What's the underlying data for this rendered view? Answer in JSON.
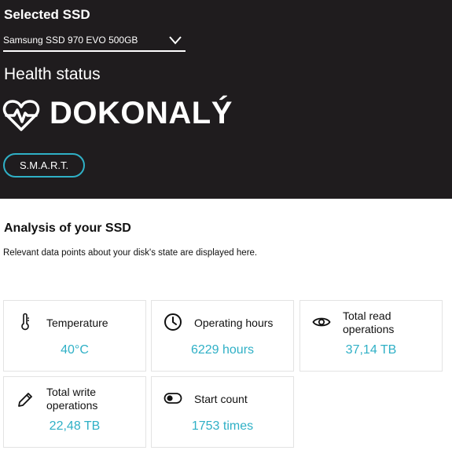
{
  "header": {
    "selected_label": "Selected SSD",
    "selected_ssd": "Samsung SSD 970 EVO 500GB",
    "health_label": "Health status",
    "health_value": "DOKONALÝ",
    "smart_button": "S.M.A.R.T."
  },
  "analysis": {
    "title": "Analysis of your SSD",
    "description": "Relevant data points about your disk's state are displayed here."
  },
  "cards": [
    {
      "label": "Temperature",
      "value": "40°C",
      "icon": "thermometer-icon"
    },
    {
      "label": "Operating hours",
      "value": "6229 hours",
      "icon": "clock-icon"
    },
    {
      "label_line1": "Total read",
      "label_line2": "operations",
      "value": "37,14 TB",
      "icon": "eye-icon"
    },
    {
      "label_line1": "Total write",
      "label_line2": "operations",
      "value": "22,48 TB",
      "icon": "pencil-icon"
    },
    {
      "label": "Start count",
      "value": "1753 times",
      "icon": "toggle-icon"
    }
  ],
  "colors": {
    "hero_bg": "#1f1c1e",
    "accent": "#2fb0c6"
  }
}
